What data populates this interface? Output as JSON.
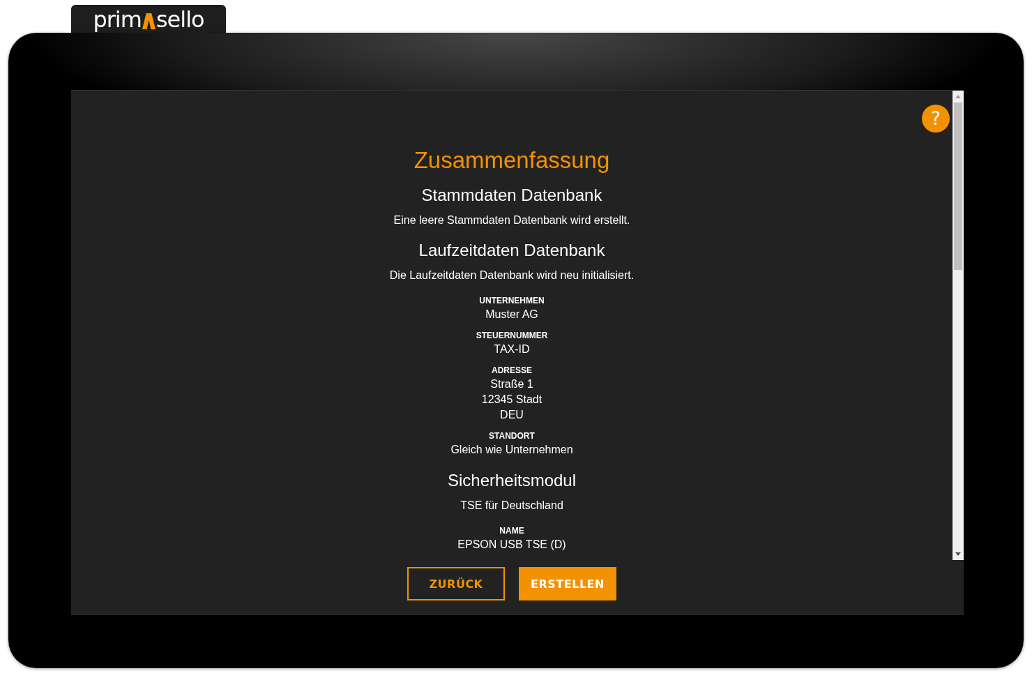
{
  "logo": {
    "before": "prim",
    "after": "sello"
  },
  "help_button": {
    "label": "?"
  },
  "title": "Zusammenfassung",
  "items": [
    {
      "kind": "heading",
      "text": "Stammdaten Datenbank"
    },
    {
      "kind": "text",
      "text": "Eine leere Stammdaten Datenbank wird erstellt."
    },
    {
      "kind": "heading",
      "text": "Laufzeitdaten Datenbank"
    },
    {
      "kind": "text",
      "text": "Die Laufzeitdaten Datenbank wird neu initialisiert."
    },
    {
      "kind": "field",
      "label": "UNTERNEHMEN",
      "lines": [
        "Muster AG"
      ]
    },
    {
      "kind": "field",
      "label": "STEUERNUMMER",
      "lines": [
        "TAX-ID"
      ]
    },
    {
      "kind": "field",
      "label": "ADRESSE",
      "lines": [
        "Straße 1",
        "12345 Stadt",
        "DEU"
      ]
    },
    {
      "kind": "field",
      "label": "STANDORT",
      "lines": [
        "Gleich wie Unternehmen"
      ]
    },
    {
      "kind": "heading",
      "text": "Sicherheitsmodul"
    },
    {
      "kind": "text",
      "text": "TSE für Deutschland"
    },
    {
      "kind": "field",
      "label": "NAME",
      "lines": [
        "EPSON USB TSE (D)"
      ]
    }
  ],
  "buttons": [
    {
      "label": "ZURÜCK",
      "kind": "outline"
    },
    {
      "label": "ERSTELLEN",
      "kind": "filled"
    }
  ]
}
